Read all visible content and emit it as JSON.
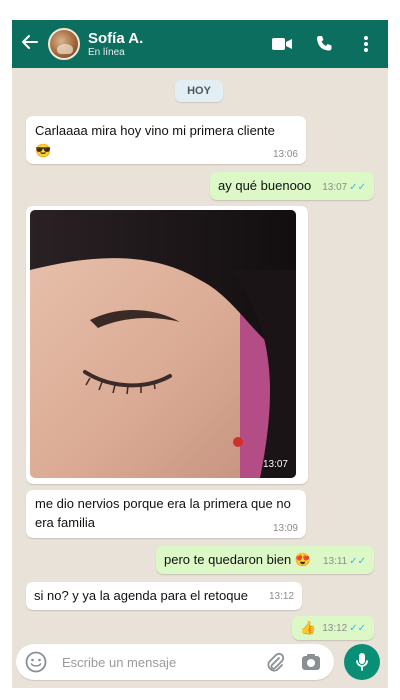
{
  "header": {
    "name": "Sofía A.",
    "status": "En línea"
  },
  "chat": {
    "day_label": "HOY",
    "messages": [
      {
        "direction": "in",
        "text": "Carlaaaa mira hoy vino mi primera cliente",
        "emoji": "😎",
        "time": "13:06"
      },
      {
        "direction": "out",
        "text": "ay qué buenooo",
        "time": "13:07",
        "ticks": "✓✓"
      },
      {
        "direction": "in",
        "type": "photo",
        "time": "13:07"
      },
      {
        "direction": "in",
        "text": "me dio nervios porque era la primera que no era familia",
        "time": "13:09"
      },
      {
        "direction": "out",
        "text": "pero te quedaron bien",
        "emoji": "😍",
        "time": "13:11",
        "ticks": "✓✓"
      },
      {
        "direction": "in",
        "text": "si no? y ya la agenda para el retoque",
        "time": "13:12"
      },
      {
        "direction": "out",
        "emoji": "👍",
        "time": "13:12",
        "ticks": "✓✓"
      }
    ]
  },
  "composer": {
    "placeholder": "Escribe un mensaje"
  },
  "icons": [
    "back-arrow-icon",
    "video-call-icon",
    "phone-icon",
    "more-vert-icon",
    "emoji-icon",
    "attach-icon",
    "camera-icon",
    "mic-icon"
  ],
  "colors": {
    "header": "#0b6e5f",
    "outgoing": "#dcf8c6",
    "incoming": "#ffffff",
    "chat_bg": "#e9e2d8",
    "read_ticks": "#34b7f1",
    "mic_button": "#0a8f77"
  }
}
